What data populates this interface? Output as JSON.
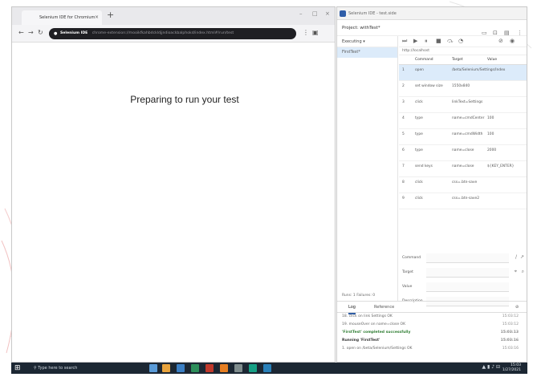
{
  "browser": {
    "tab_title": "Selenium IDE for Chromium",
    "tab_close": "×",
    "new_tab": "+",
    "url_label": "Selenium IDE",
    "url_text": "chrome-extension://mooikfkahbdckldjjndioackbalphokd/index.html#/run/test",
    "page_message": "Preparing to run your test",
    "window_controls": [
      "–",
      "□",
      "×"
    ]
  },
  "ide": {
    "title": "Selenium IDE - test.side",
    "project_label": "Project: withTest*",
    "executing_label": "Executing",
    "test_name": "FirstTest*",
    "url_field": "http://localhost",
    "columns": [
      "Command",
      "Target",
      "Value"
    ],
    "commands": [
      {
        "num": "1",
        "command": "open",
        "target": "/beta/Selenium/Settings/Index",
        "value": ""
      },
      {
        "num": "2",
        "command": "set window size",
        "target": "1550x840",
        "value": ""
      },
      {
        "num": "3",
        "command": "click",
        "target": "linkText=Settings",
        "value": ""
      },
      {
        "num": "4",
        "command": "type",
        "target": "name=cmdCenter",
        "value": "100"
      },
      {
        "num": "5",
        "command": "type",
        "target": "name=cmdWidth",
        "value": "100"
      },
      {
        "num": "6",
        "command": "type",
        "target": "name=close",
        "value": "2000"
      },
      {
        "num": "7",
        "command": "send keys",
        "target": "name=close",
        "value": "${KEY_ENTER}"
      },
      {
        "num": "8",
        "command": "click",
        "target": "css=.btn-save",
        "value": ""
      },
      {
        "num": "9",
        "command": "click",
        "target": "css=.btn-save2",
        "value": ""
      }
    ],
    "form_labels": {
      "command": "Command",
      "target": "Target",
      "value": "Value",
      "description": "Description"
    },
    "left_footer": "Runs: 1   Failures: 0",
    "log_tabs": [
      "Log",
      "Reference"
    ],
    "log_lines": [
      {
        "text": "18. click on link Settings OK",
        "time": "15:03:12",
        "kind": "info"
      },
      {
        "text": "19. mouseOver on name=close OK",
        "time": "15:03:12",
        "kind": "info"
      },
      {
        "text": "'FirstTest' completed successfully",
        "time": "15:03:13",
        "kind": "ok"
      },
      {
        "text": "Running 'FirstTest'",
        "time": "15:03:16",
        "kind": "run"
      },
      {
        "text": "1. open on /beta/Selenium/Settings OK",
        "time": "15:03:16",
        "kind": "info"
      }
    ]
  },
  "taskbar": {
    "search_placeholder": "Type here to search",
    "clock_time": "15:03",
    "clock_date": "1/27/2021",
    "app_colors": [
      "#5a9bd8",
      "#e8a33d",
      "#3b7fc4",
      "#2c8e5a",
      "#c0392b",
      "#e67e22",
      "#7f8c8d",
      "#16a085",
      "#2980b9"
    ]
  }
}
